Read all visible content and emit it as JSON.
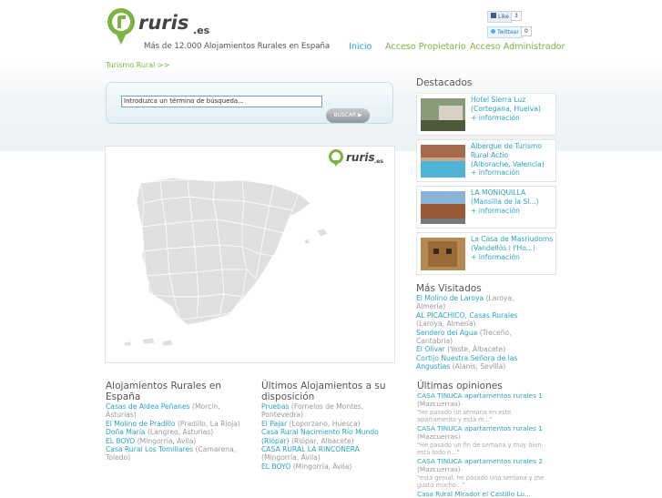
{
  "header": {
    "logo_alt": "ruris.es",
    "tagline": "Más de 12.000 Alojamientos Rurales en España",
    "like_label": "Like",
    "like_count": "3",
    "tweet_label": "Twittear",
    "tweet_count": "0"
  },
  "nav": {
    "items": [
      "Inicio",
      "Acceso Propietario",
      "Acceso Administrador"
    ]
  },
  "breadcrumb": "Turismo Rural >>",
  "search": {
    "placeholder": "Introduzca un término de búsqueda...",
    "button": "BUSCAR"
  },
  "featured": {
    "title": "Destacados",
    "items": [
      {
        "name": "Hotel Sierra Luz",
        "location": "(Cortegana, Huelva)",
        "more": "+ información"
      },
      {
        "name": "Albergue de Turismo Rural Actio",
        "location": "(Alborache, Valencia)",
        "more": "+ información"
      },
      {
        "name": "LA MONIQUILLA",
        "location": "(Mansilla de la Sl...)",
        "more": "+ información"
      },
      {
        "name": "La Casa de Masriudoms",
        "location": "(Vandellòs i l'Ho...)",
        "more": "+ información"
      }
    ]
  },
  "most_visited": {
    "title": "Más Visitados",
    "items": [
      {
        "name": "El Molino de Laroya",
        "location": "(Laroya, Almería)"
      },
      {
        "name": "AL PICACHICO, Casas Rurales",
        "location": "(Laroya, Almería)"
      },
      {
        "name": "Sendero del Agua",
        "location": "(Treceño, Cantabria)"
      },
      {
        "name": "El Olivar",
        "location": "(Yeste, Albacete)"
      },
      {
        "name": "Cortijo Nuestra Señora de las Angustias",
        "location": "(Alanís, Sevilla)"
      }
    ]
  },
  "col1": {
    "title": "Alojamientos Rurales en España",
    "items": [
      {
        "name": "Casas de Aldea Peñanes",
        "location": "(Morcín, Asturias)"
      },
      {
        "name": "El Molino de Pradillo",
        "location": "(Pradillo, La Rioja)"
      },
      {
        "name": "Doña María",
        "location": "(Langreo, Asturias)"
      },
      {
        "name": "EL BOYO",
        "location": "(Mingorría, Ávila)"
      },
      {
        "name": "Casa Rural Los Tomillares",
        "location": "(Camarena, Toledo)"
      }
    ]
  },
  "col2": {
    "title": "Últimos Alojamientos a su disposición",
    "items": [
      {
        "name": "Pruebas",
        "location": "(Fornelos de Montes, Pontevedra)"
      },
      {
        "name": "El Pajar",
        "location": "(Loporzano, Huesca)"
      },
      {
        "name": "Casa Rural Nacimiento Río Mundo (Riópar)",
        "location": "(Riópar, Albacete)"
      },
      {
        "name": "CASA RURAL LA RINCONERA",
        "location": "(Mingorría, Ávila)"
      },
      {
        "name": "EL BOYO",
        "location": "(Mingorría, Ávila)"
      }
    ]
  },
  "col3": {
    "title": "Últimas opiniones",
    "items": [
      {
        "name": "CASA TINUCA apartamentos rurales 1",
        "location": "(Mazcuerras)",
        "quote": "\"He pasado un semana en este apartamento y está m...\""
      },
      {
        "name": "CASA TINUCA apartamentos rurales 1",
        "location": "(Mazcuerras)",
        "quote": "\"He pasado un fin de semana y muy bien, está todo n...\""
      },
      {
        "name": "CASA TINUCA apartamentos rurales 2",
        "location": "(Mazcuerras)",
        "quote": "\"está genial, he pasado una semana y me gustó mucho...\""
      },
      {
        "name": "Casa Rural Mirador el Castillo Lu...",
        "location": "",
        "quote": ""
      }
    ]
  },
  "colors": {
    "brand_green": "#7cb342",
    "link_blue": "#2aa3c4"
  }
}
